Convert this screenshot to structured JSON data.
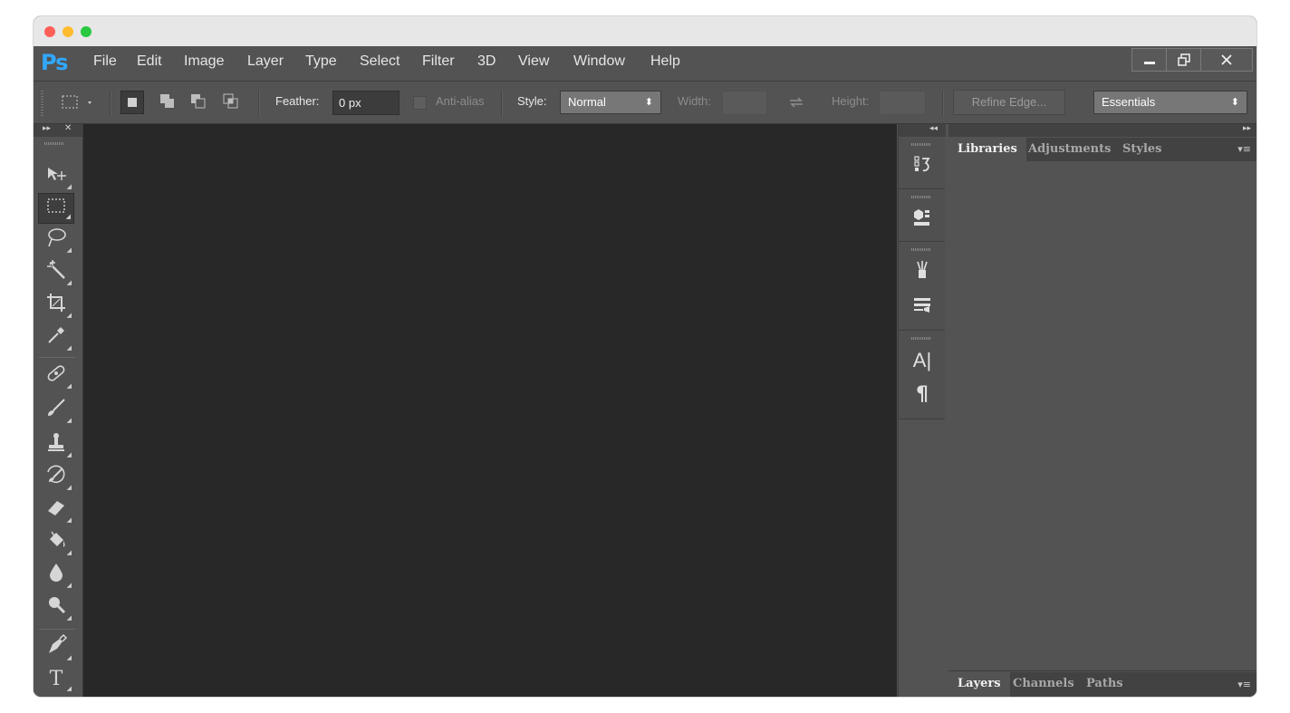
{
  "app": {
    "logo": "Ps",
    "menu": [
      "File",
      "Edit",
      "Image",
      "Layer",
      "Type",
      "Select",
      "Filter",
      "3D",
      "View",
      "Window",
      "Help"
    ],
    "window_controls": [
      "minimize-icon",
      "restore-icon",
      "close-icon"
    ]
  },
  "options_bar": {
    "tool_icon": "rectangular-marquee-icon",
    "selection_modes": [
      "new-selection-icon",
      "add-to-selection-icon",
      "subtract-from-selection-icon",
      "intersect-selection-icon"
    ],
    "feather_label": "Feather:",
    "feather_value": "0 px",
    "antialias_label": "Anti-alias",
    "style_label": "Style:",
    "style_value": "Normal",
    "width_label": "Width:",
    "height_label": "Height:",
    "refine_edge_label": "Refine Edge...",
    "workspace_value": "Essentials"
  },
  "tools": [
    {
      "name": "move-tool",
      "icon": "move-icon"
    },
    {
      "name": "rectangular-marquee-tool",
      "icon": "marquee-icon",
      "active": true
    },
    {
      "name": "lasso-tool",
      "icon": "lasso-icon"
    },
    {
      "name": "magic-wand-tool",
      "icon": "magic-wand-icon"
    },
    {
      "name": "crop-tool",
      "icon": "crop-icon"
    },
    {
      "name": "eyedropper-tool",
      "icon": "eyedropper-icon"
    },
    {
      "name": "healing-brush-tool",
      "icon": "bandage-icon"
    },
    {
      "name": "brush-tool",
      "icon": "brush-icon"
    },
    {
      "name": "clone-stamp-tool",
      "icon": "stamp-icon"
    },
    {
      "name": "history-brush-tool",
      "icon": "history-brush-icon"
    },
    {
      "name": "eraser-tool",
      "icon": "eraser-icon"
    },
    {
      "name": "paint-bucket-tool",
      "icon": "paint-bucket-icon"
    },
    {
      "name": "blur-tool",
      "icon": "drop-icon"
    },
    {
      "name": "dodge-tool",
      "icon": "dodge-icon"
    },
    {
      "name": "pen-tool",
      "icon": "pen-icon"
    },
    {
      "name": "type-tool",
      "icon": "type-icon",
      "glyph": "T"
    }
  ],
  "dock": {
    "icons": [
      "history-icon",
      "3d-icon",
      "brushes-icon",
      "brush-presets-icon",
      "character-icon",
      "paragraph-icon"
    ],
    "character_glyph": "A|",
    "paragraph_glyph": "¶"
  },
  "right_panel": {
    "top_tabs": [
      "Libraries",
      "Adjustments",
      "Styles"
    ],
    "bottom_tabs": [
      "Layers",
      "Channels",
      "Paths"
    ]
  },
  "colors": {
    "ps_blue": "#31a8ff",
    "panel_bg": "#535353",
    "canvas_bg": "#282828",
    "field_bg": "#3c3c3c"
  }
}
